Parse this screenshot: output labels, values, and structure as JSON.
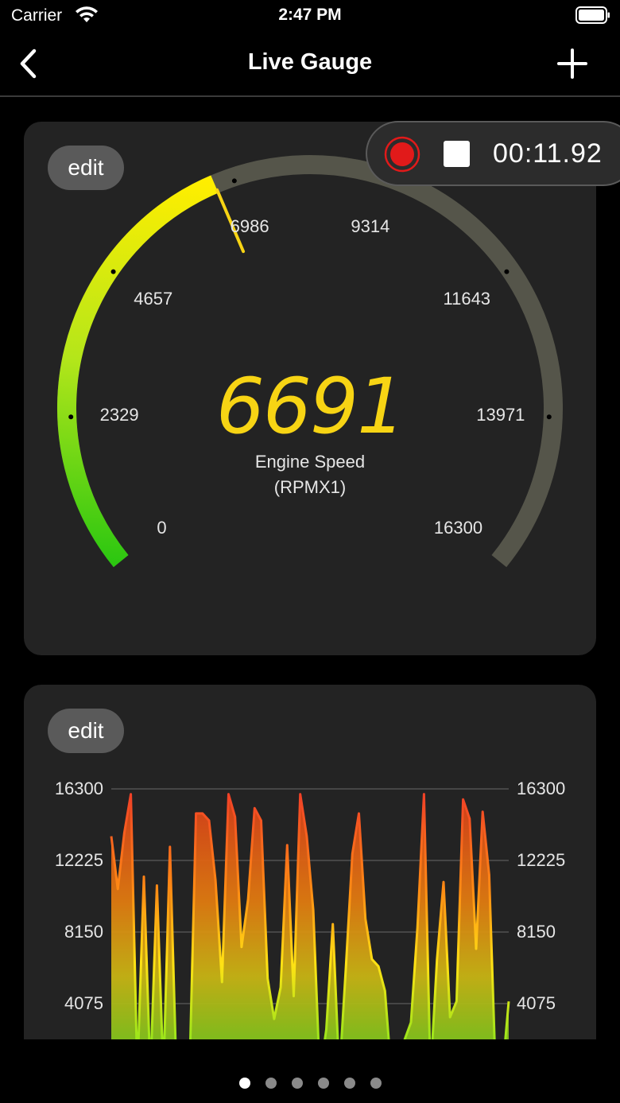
{
  "status_bar": {
    "carrier": "Carrier",
    "time": "2:47 PM"
  },
  "nav": {
    "title": "Live Gauge",
    "back_icon": "chevron-left-icon",
    "add_icon": "plus-icon"
  },
  "recorder": {
    "elapsed": "00:11.92",
    "record_color": "#e11a1a"
  },
  "gauge": {
    "edit_label": "edit",
    "value": "6691",
    "name": "Engine Speed",
    "unit": "(RPMX1)",
    "min": 0,
    "max": 16300,
    "current": 6691,
    "tick_labels": [
      "0",
      "2329",
      "4657",
      "6986",
      "9314",
      "11643",
      "13971",
      "16300"
    ],
    "value_color": "#f7d414",
    "track_color": "#55554a",
    "gradient_colors": [
      "#17c20f",
      "#b4e61a",
      "#ffee00"
    ]
  },
  "graph": {
    "edit_label": "edit",
    "axis_labels": [
      "16300",
      "12225",
      "8150",
      "4075"
    ]
  },
  "chart_data": {
    "type": "area",
    "ylim": [
      0,
      16300
    ],
    "y_ticks": [
      16300,
      12225,
      8150,
      4075
    ],
    "grid": true,
    "values": [
      13600,
      10600,
      13800,
      16000,
      0,
      11300,
      0,
      10800,
      0,
      13000,
      0,
      0,
      0,
      14900,
      14900,
      14500,
      11100,
      5300,
      16000,
      14700,
      7300,
      10000,
      15200,
      14500,
      5500,
      3200,
      5000,
      13100,
      4500,
      16000,
      13600,
      9400,
      0,
      2600,
      8600,
      0,
      6100,
      12600,
      14900,
      8900,
      6600,
      6200,
      4800,
      0,
      0,
      2000,
      3000,
      8400,
      16000,
      0,
      6600,
      11000,
      3300,
      4200,
      15700,
      14600,
      7200,
      15000,
      11400,
      0,
      0,
      4200
    ]
  },
  "pager": {
    "page_count": 6,
    "active_index": 0
  }
}
